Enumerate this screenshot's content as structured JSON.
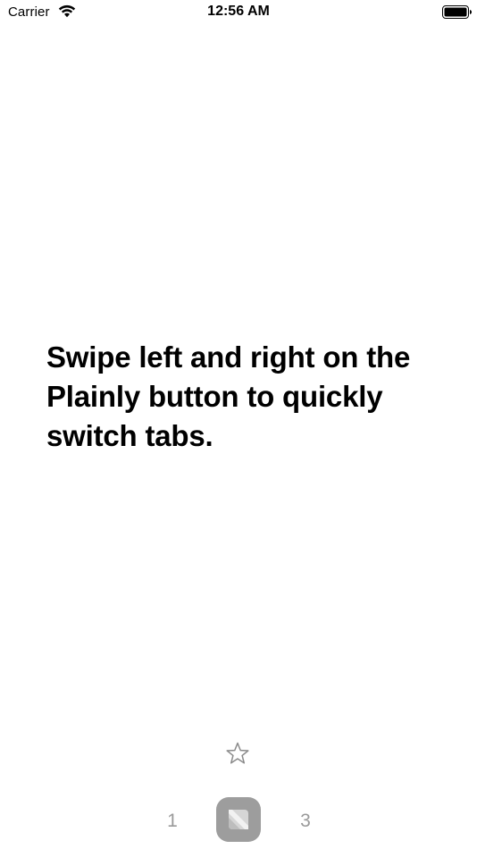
{
  "status_bar": {
    "carrier": "Carrier",
    "time": "12:56 AM",
    "icons": [
      "wifi-icon",
      "battery-icon"
    ]
  },
  "onboarding": {
    "message": "Swipe left and right on the Plainly button to quickly switch tabs."
  },
  "toolbar": {
    "star_icon": "star-outline-icon",
    "tabs": [
      {
        "label": "1"
      },
      {
        "label": "3"
      }
    ],
    "plainly_icon": "plainly-logo-icon"
  },
  "colors": {
    "background": "#ffffff",
    "text": "#000000",
    "tab_number": "#9a9a9a",
    "plainly_button": "#9d9d9d"
  }
}
